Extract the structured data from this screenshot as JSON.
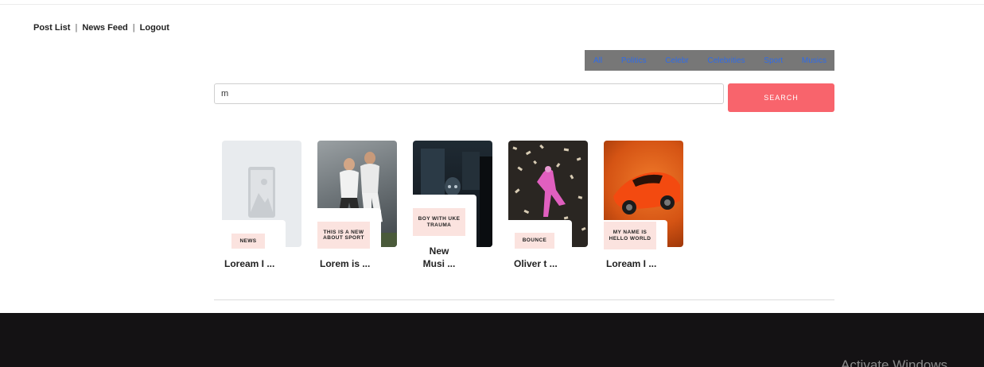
{
  "nav": {
    "post_list": "Post List",
    "news_feed": "News Feed",
    "logout": "Logout",
    "separator": "|"
  },
  "categories": [
    "All",
    "Politics",
    "Celebr",
    "Celebrities",
    "Sport",
    "Musics"
  ],
  "search": {
    "value": "m",
    "button_label": "SEARCH"
  },
  "posts": [
    {
      "tag": "NEWS",
      "title": "Loream I ...",
      "image": "placeholder-image-icon"
    },
    {
      "tag": "THIS IS A NEW ABOUT SPORT",
      "title": "Lorem is ...",
      "image": "football-players-photo"
    },
    {
      "tag": "BOY WITH UKE TRAUMA",
      "title": "New Musi ...",
      "image": "dark-room-figure-photo"
    },
    {
      "tag": "BOUNCE",
      "title": "Oliver t ...",
      "image": "pink-dancer-photo"
    },
    {
      "tag": "MY NAME IS HELLO WORLD",
      "title": "Loream I ...",
      "image": "orange-sports-car-photo"
    }
  ],
  "watermark": "Activate Windows",
  "colors": {
    "accent": "#f8646c",
    "category_bar": "#777777",
    "category_link": "#2f6be8",
    "tag_bg": "#fbe3df",
    "footer": "#141214"
  }
}
